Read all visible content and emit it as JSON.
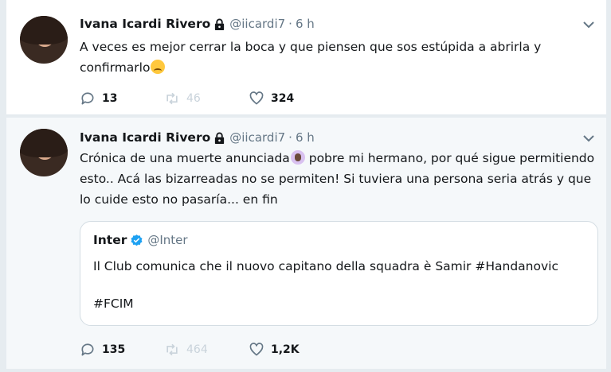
{
  "tweets": [
    {
      "name": "Ivana Icardi Rivero",
      "handle": "@iicardi7",
      "separator": "·",
      "time": "6 h",
      "text": "A veces es mejor cerrar la boca y que piensen que sos estúpida a abrirla y confirmarlo",
      "emoji": "disappointed-relieved-face",
      "reply_count": "13",
      "retweet_count": "46",
      "like_count": "324"
    },
    {
      "name": "Ivana Icardi Rivero",
      "handle": "@iicardi7",
      "separator": "·",
      "time": "6 h",
      "text_before_emoji": "Crónica de una muerte anunciada",
      "emoji": "woman-facepalming",
      "text_after_emoji": " pobre mi hermano, por qué sigue permitiendo esto.. Acá las bizarreadas no se permiten! Si tuviera una persona seria atrás y que lo cuide esto no pasaría... en fin",
      "quote": {
        "name": "Inter",
        "handle": "@Inter",
        "text": "Il Club comunica che il nuovo capitano della squadra è Samir #Handanovic",
        "hashtag": "#FCIM"
      },
      "reply_count": "135",
      "retweet_count": "464",
      "like_count": "1,2K"
    }
  ],
  "colors": {
    "text": "#14171a",
    "muted": "#657786",
    "faded": "#c9d3db",
    "verified": "#1da1f2",
    "background": "#e6ecf0"
  }
}
